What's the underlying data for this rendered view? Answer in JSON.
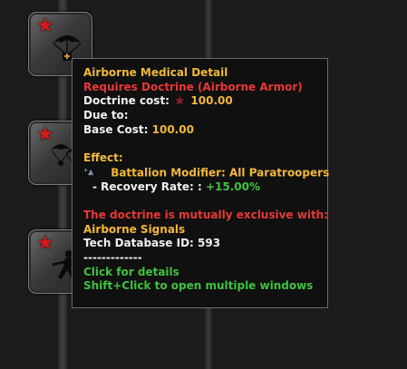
{
  "tooltip": {
    "title": "Airborne Medical Detail",
    "requires": "Requires Doctrine (Airborne Armor)",
    "doctrine_cost_label": "Doctrine cost:",
    "doctrine_cost_value": "100.00",
    "due_to_label": "Due to:",
    "base_cost_label": "Base Cost:",
    "base_cost_value": "100.00",
    "effect_label": "Effect:",
    "modifier_label": "Battalion Modifier: All Paratroopers",
    "recovery_label": "- Recovery Rate: :",
    "recovery_value": "+15.00%",
    "exclusive_label": "The doctrine is mutually exclusive with:",
    "exclusive_item": "Airborne Signals",
    "tech_db": "Tech Database ID: 593",
    "separator": "-------------",
    "click_details": "Click for details",
    "shift_click": "Shift+Click to open multiple windows"
  },
  "tiles": [
    {
      "name": "airborne-medical-detail",
      "icon": "parachute-medic-icon"
    },
    {
      "name": "airborne-paratroopers",
      "icon": "parachute-troops-icon"
    },
    {
      "name": "airborne-assault",
      "icon": "soldier-charge-icon"
    }
  ],
  "colors": {
    "gold": "#f2b83a",
    "red": "#e83838",
    "green": "#3fc23f",
    "star_red": "#d41a1a"
  }
}
